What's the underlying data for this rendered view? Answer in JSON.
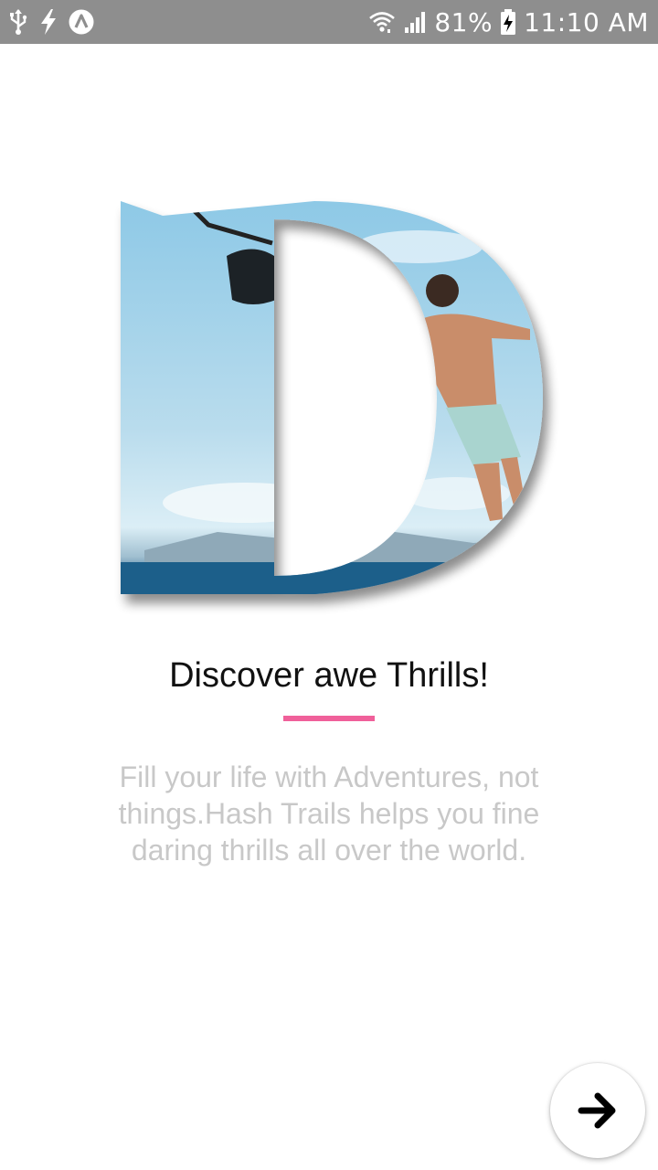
{
  "status_bar": {
    "battery_percent": "81%",
    "time": "11:10 AM",
    "icons": [
      "usb-icon",
      "charging-bolt-icon",
      "app-notification-icon",
      "wifi-icon",
      "signal-icon",
      "battery-charging-icon"
    ]
  },
  "onboarding": {
    "hero_letter": "D",
    "hero_image": "person-jumping-into-sea-photo",
    "title": "Discover awe Thrills!",
    "description_lines": [
      "Fill your life with Adventures, not",
      "things.Hash Trails helps you fine",
      "daring thrills all over the world."
    ],
    "accent_color": "#f0609a",
    "next_icon": "arrow-right-icon"
  }
}
